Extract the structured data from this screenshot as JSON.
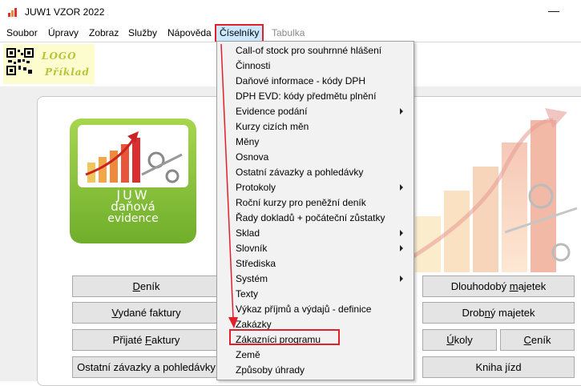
{
  "window": {
    "title": "JUW1 VZOR 2022",
    "minimize": "—"
  },
  "menubar": [
    {
      "label": "Soubor"
    },
    {
      "label": "Úpravy"
    },
    {
      "label": "Zobraz"
    },
    {
      "label": "Služby"
    },
    {
      "label": "Nápověda"
    },
    {
      "label": "Číselníky"
    },
    {
      "label": "Tabulka"
    }
  ],
  "logo": {
    "line1": "LOGO",
    "line2": "Příklad"
  },
  "product": {
    "line1": "JUW",
    "line2": "daňová",
    "line3": "evidence"
  },
  "dropdown": [
    {
      "label": "Call-of stock pro souhrnné hlášení",
      "submenu": false
    },
    {
      "label": "Činnosti",
      "submenu": false
    },
    {
      "label": "Daňové informace - kódy DPH",
      "submenu": false
    },
    {
      "label": "DPH EVD: kódy předmětu plnění",
      "submenu": false
    },
    {
      "label": "Evidence podání",
      "submenu": true
    },
    {
      "label": "Kurzy cizích měn",
      "submenu": false
    },
    {
      "label": "Měny",
      "submenu": false
    },
    {
      "label": "Osnova",
      "submenu": false
    },
    {
      "label": "Ostatní závazky a pohledávky",
      "submenu": false
    },
    {
      "label": "Protokoly",
      "submenu": true
    },
    {
      "label": "Roční kurzy pro peněžní deník",
      "submenu": false
    },
    {
      "label": "Řady dokladů + počáteční zůstatky",
      "submenu": false
    },
    {
      "label": "Sklad",
      "submenu": true
    },
    {
      "label": "Slovník",
      "submenu": true
    },
    {
      "label": "Střediska",
      "submenu": false
    },
    {
      "label": "Systém",
      "submenu": true
    },
    {
      "label": "Texty",
      "submenu": false
    },
    {
      "label": "Výkaz příjmů a výdajů - definice",
      "submenu": false
    },
    {
      "label": "Zakázky",
      "submenu": false
    },
    {
      "label": "Zákazníci programu",
      "submenu": false
    },
    {
      "label": "Země",
      "submenu": false
    },
    {
      "label": "Způsoby úhrady",
      "submenu": false
    }
  ],
  "buttons": {
    "denik": {
      "u": "D",
      "rest": "eník"
    },
    "vydane": {
      "u": "V",
      "rest": "ydané faktury"
    },
    "prijate": {
      "pre": "Přijaté ",
      "u": "F",
      "rest": "aktury"
    },
    "ostatni": {
      "label": "Ostatní závazky a pohledávky"
    },
    "dlouhodoby": {
      "pre": "Dlouhodobý ",
      "u": "m",
      "rest": "ajetek"
    },
    "drobny": {
      "pre": "Drob",
      "u": "n",
      "rest": "ý majetek"
    },
    "ukoly": {
      "u": "Ú",
      "rest": "koly"
    },
    "cenik": {
      "u": "C",
      "rest": "eník"
    },
    "kniha": {
      "label": "Kniha jízd"
    }
  },
  "colors": {
    "highlight": "#e0202a",
    "menu_active_bg": "#cce8ff",
    "logo_bg": "#fdfccf",
    "product_green": "#8cc43a"
  }
}
